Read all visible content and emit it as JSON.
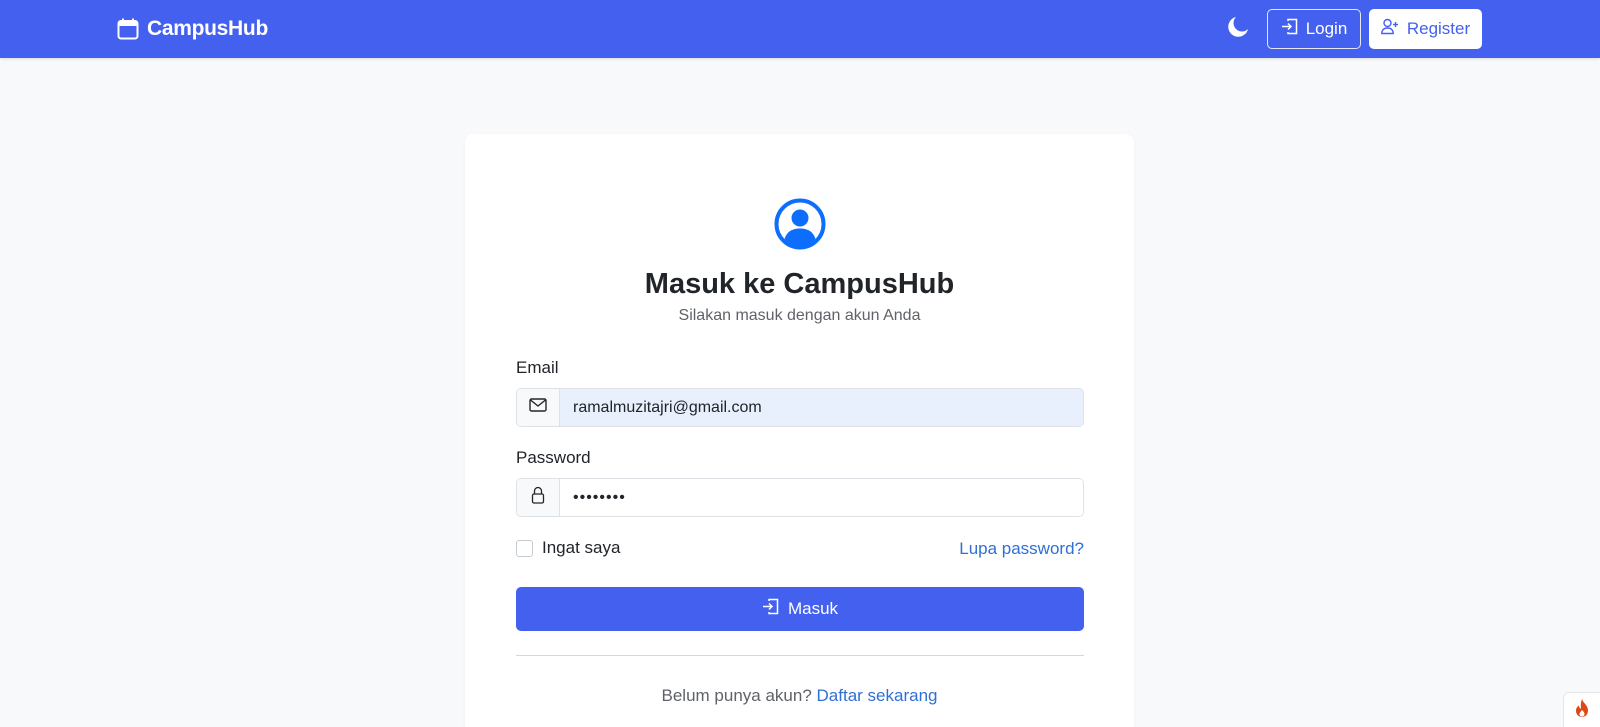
{
  "navbar": {
    "brand": "CampusHub",
    "login_label": "Login",
    "register_label": "Register"
  },
  "login_card": {
    "title": "Masuk ke CampusHub",
    "subtitle": "Silakan masuk dengan akun Anda",
    "email_label": "Email",
    "email_value": "ramalmuzitajri@gmail.com",
    "password_label": "Password",
    "password_value": "••••••••",
    "remember_label": "Ingat saya",
    "remember_checked": false,
    "forgot_link": "Lupa password?",
    "submit_label": "Masuk",
    "no_account_text": "Belum punya akun?",
    "signup_link": "Daftar sekarang"
  },
  "icons": {
    "brand": "calendar-icon",
    "theme": "moon-icon",
    "login": "box-arrow-in-right-icon",
    "register": "person-plus-icon",
    "avatar": "person-circle-icon",
    "email": "envelope-icon",
    "password": "lock-icon",
    "corner": "flame-icon"
  },
  "colors": {
    "primary": "#4361ee",
    "link": "#2f6fd6",
    "avatar": "#0d6efd",
    "page_bg": "#f8f9fb",
    "autofill_bg": "#e8f0fe"
  }
}
